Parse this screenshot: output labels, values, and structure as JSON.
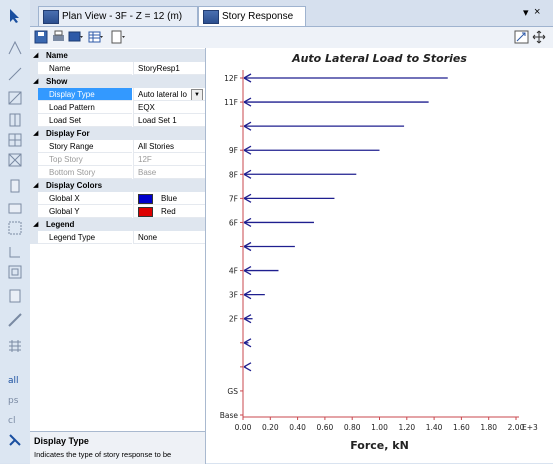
{
  "tabs": [
    {
      "label": "Plan View - 3F - Z = 12 (m)",
      "active": false
    },
    {
      "label": "Story Response",
      "active": true
    }
  ],
  "window_controls": {
    "dropdown": "▾",
    "close": "×"
  },
  "properties": {
    "name_cat": "Name",
    "name_label": "Name",
    "name_value": "StoryResp1",
    "show_cat": "Show",
    "display_type_label": "Display Type",
    "display_type_value": "Auto lateral lo",
    "load_pattern_label": "Load Pattern",
    "load_pattern_value": "EQX",
    "load_set_label": "Load Set",
    "load_set_value": "Load Set 1",
    "display_for_cat": "Display For",
    "story_range_label": "Story Range",
    "story_range_value": "All Stories",
    "top_story_label": "Top Story",
    "top_story_value": "12F",
    "bottom_story_label": "Bottom Story",
    "bottom_story_value": "Base",
    "display_colors_cat": "Display Colors",
    "global_x_label": "Global X",
    "global_x_value": "Blue",
    "global_x_color": "#0000cc",
    "global_y_label": "Global Y",
    "global_y_value": "Red",
    "global_y_color": "#dd0000",
    "legend_cat": "Legend",
    "legend_type_label": "Legend Type",
    "legend_type_value": "None"
  },
  "description": {
    "title": "Display Type",
    "text": "Indicates the type of story response to be"
  },
  "chart_data": {
    "type": "bar",
    "orientation": "horizontal",
    "title": "Auto Lateral Load to Stories",
    "xlabel": "Force, kN",
    "x_exponent_label": "E+3",
    "xlim": [
      0,
      2.0
    ],
    "xticks": [
      "0.00",
      "0.20",
      "0.40",
      "0.60",
      "0.80",
      "1.00",
      "1.20",
      "1.40",
      "1.60",
      "1.80",
      "2.00"
    ],
    "stories": [
      "Base",
      "GS",
      "",
      "",
      "2F",
      "3F",
      "4F",
      "",
      "6F",
      "7F",
      "8F",
      "9F",
      "",
      "11F",
      "12F"
    ],
    "values": [
      0,
      0,
      0.02,
      0.04,
      0.07,
      0.16,
      0.26,
      0.38,
      0.52,
      0.67,
      0.83,
      1.0,
      1.18,
      1.36,
      1.5
    ],
    "bar_color": "#1f1f8f",
    "axis_color": "#c8474d",
    "grid": false
  }
}
